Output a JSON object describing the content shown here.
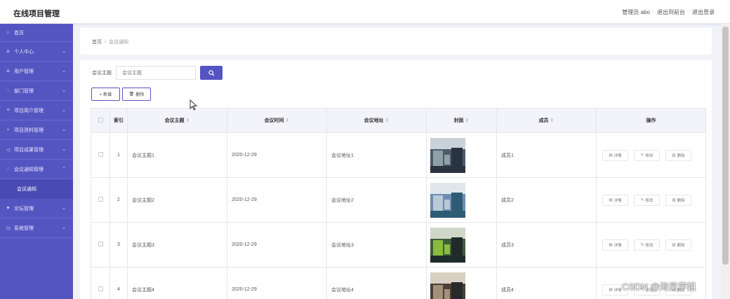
{
  "header": {
    "app_title": "在线项目管理",
    "admin_label": "管理员 abo",
    "to_front": "退出到前台",
    "logout": "退出登录"
  },
  "sidebar": {
    "items": [
      {
        "label": "首页",
        "icon": "home-icon"
      },
      {
        "label": "个人中心",
        "icon": "user-icon",
        "expandable": true
      },
      {
        "label": "用户管理",
        "icon": "user-icon",
        "expandable": true
      },
      {
        "label": "部门管理",
        "icon": "gear-icon",
        "expandable": true
      },
      {
        "label": "项目简介管理",
        "icon": "list-icon",
        "expandable": true
      },
      {
        "label": "项目资料管理",
        "icon": "chat-icon",
        "expandable": true
      },
      {
        "label": "项目成果管理",
        "icon": "send-icon",
        "expandable": true
      },
      {
        "label": "会议通知管理",
        "icon": "gear-icon",
        "expandable": true,
        "open": true
      }
    ],
    "subitem": "会议通知",
    "items_after": [
      {
        "label": "论坛管理",
        "icon": "shield-icon"
      },
      {
        "label": "系统管理",
        "icon": "clock-icon"
      }
    ],
    "colors": {
      "bg": "#5555c2",
      "sub_bg": "#4a4ab4"
    }
  },
  "breadcrumb": {
    "home": "首页",
    "separator": "/",
    "current": "会议通知"
  },
  "search": {
    "label": "会议主题",
    "placeholder": "会议主题"
  },
  "actions": {
    "add": "+ 新增",
    "delete": "删除"
  },
  "table": {
    "headers": [
      "索引",
      "会议主题",
      "会议时间",
      "会议地址",
      "封面",
      "成员",
      "操作"
    ],
    "rows": [
      {
        "index": "1",
        "topic": "会议主题1",
        "time": "2020-12-29",
        "address": "会议地址1",
        "member": "成员1"
      },
      {
        "index": "2",
        "topic": "会议主题2",
        "time": "2020-12-29",
        "address": "会议地址2",
        "member": "成员2"
      },
      {
        "index": "3",
        "topic": "会议主题3",
        "time": "2020-12-29",
        "address": "会议地址3",
        "member": "成员3"
      },
      {
        "index": "4",
        "topic": "会议主题4",
        "time": "2020-12-29",
        "address": "会议地址4",
        "member": "成员4"
      }
    ],
    "row_ops": {
      "detail": "详情",
      "edit": "修改",
      "delete": "删除"
    }
  },
  "watermark": "CSDN @海灵学姐"
}
